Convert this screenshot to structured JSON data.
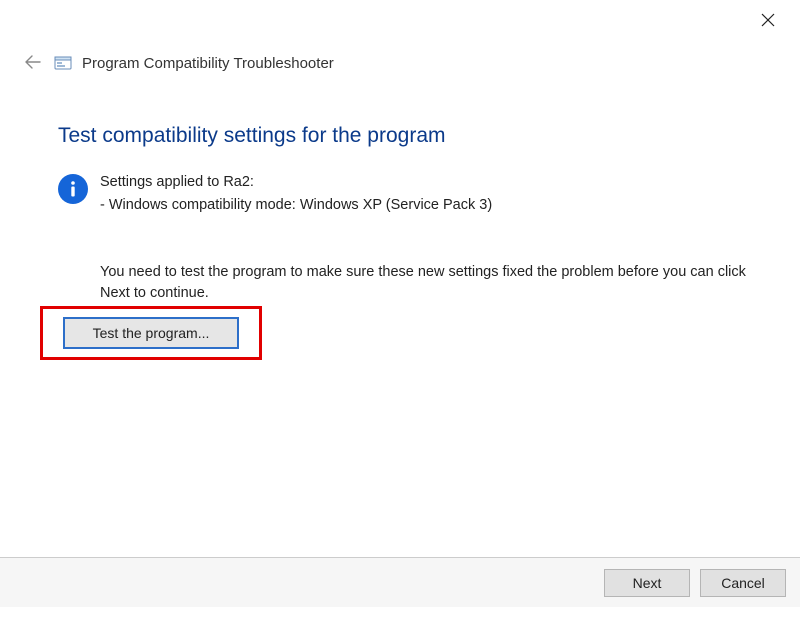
{
  "window": {
    "app_title": "Program Compatibility Troubleshooter"
  },
  "page": {
    "title": "Test compatibility settings for the program"
  },
  "info": {
    "line1": "Settings applied to Ra2:",
    "line2": "- Windows compatibility mode: Windows XP (Service Pack 3)",
    "instruction": "You need to test the program to make sure these new settings fixed the problem before you can click Next to continue."
  },
  "buttons": {
    "test": "Test the program...",
    "next": "Next",
    "cancel": "Cancel"
  }
}
